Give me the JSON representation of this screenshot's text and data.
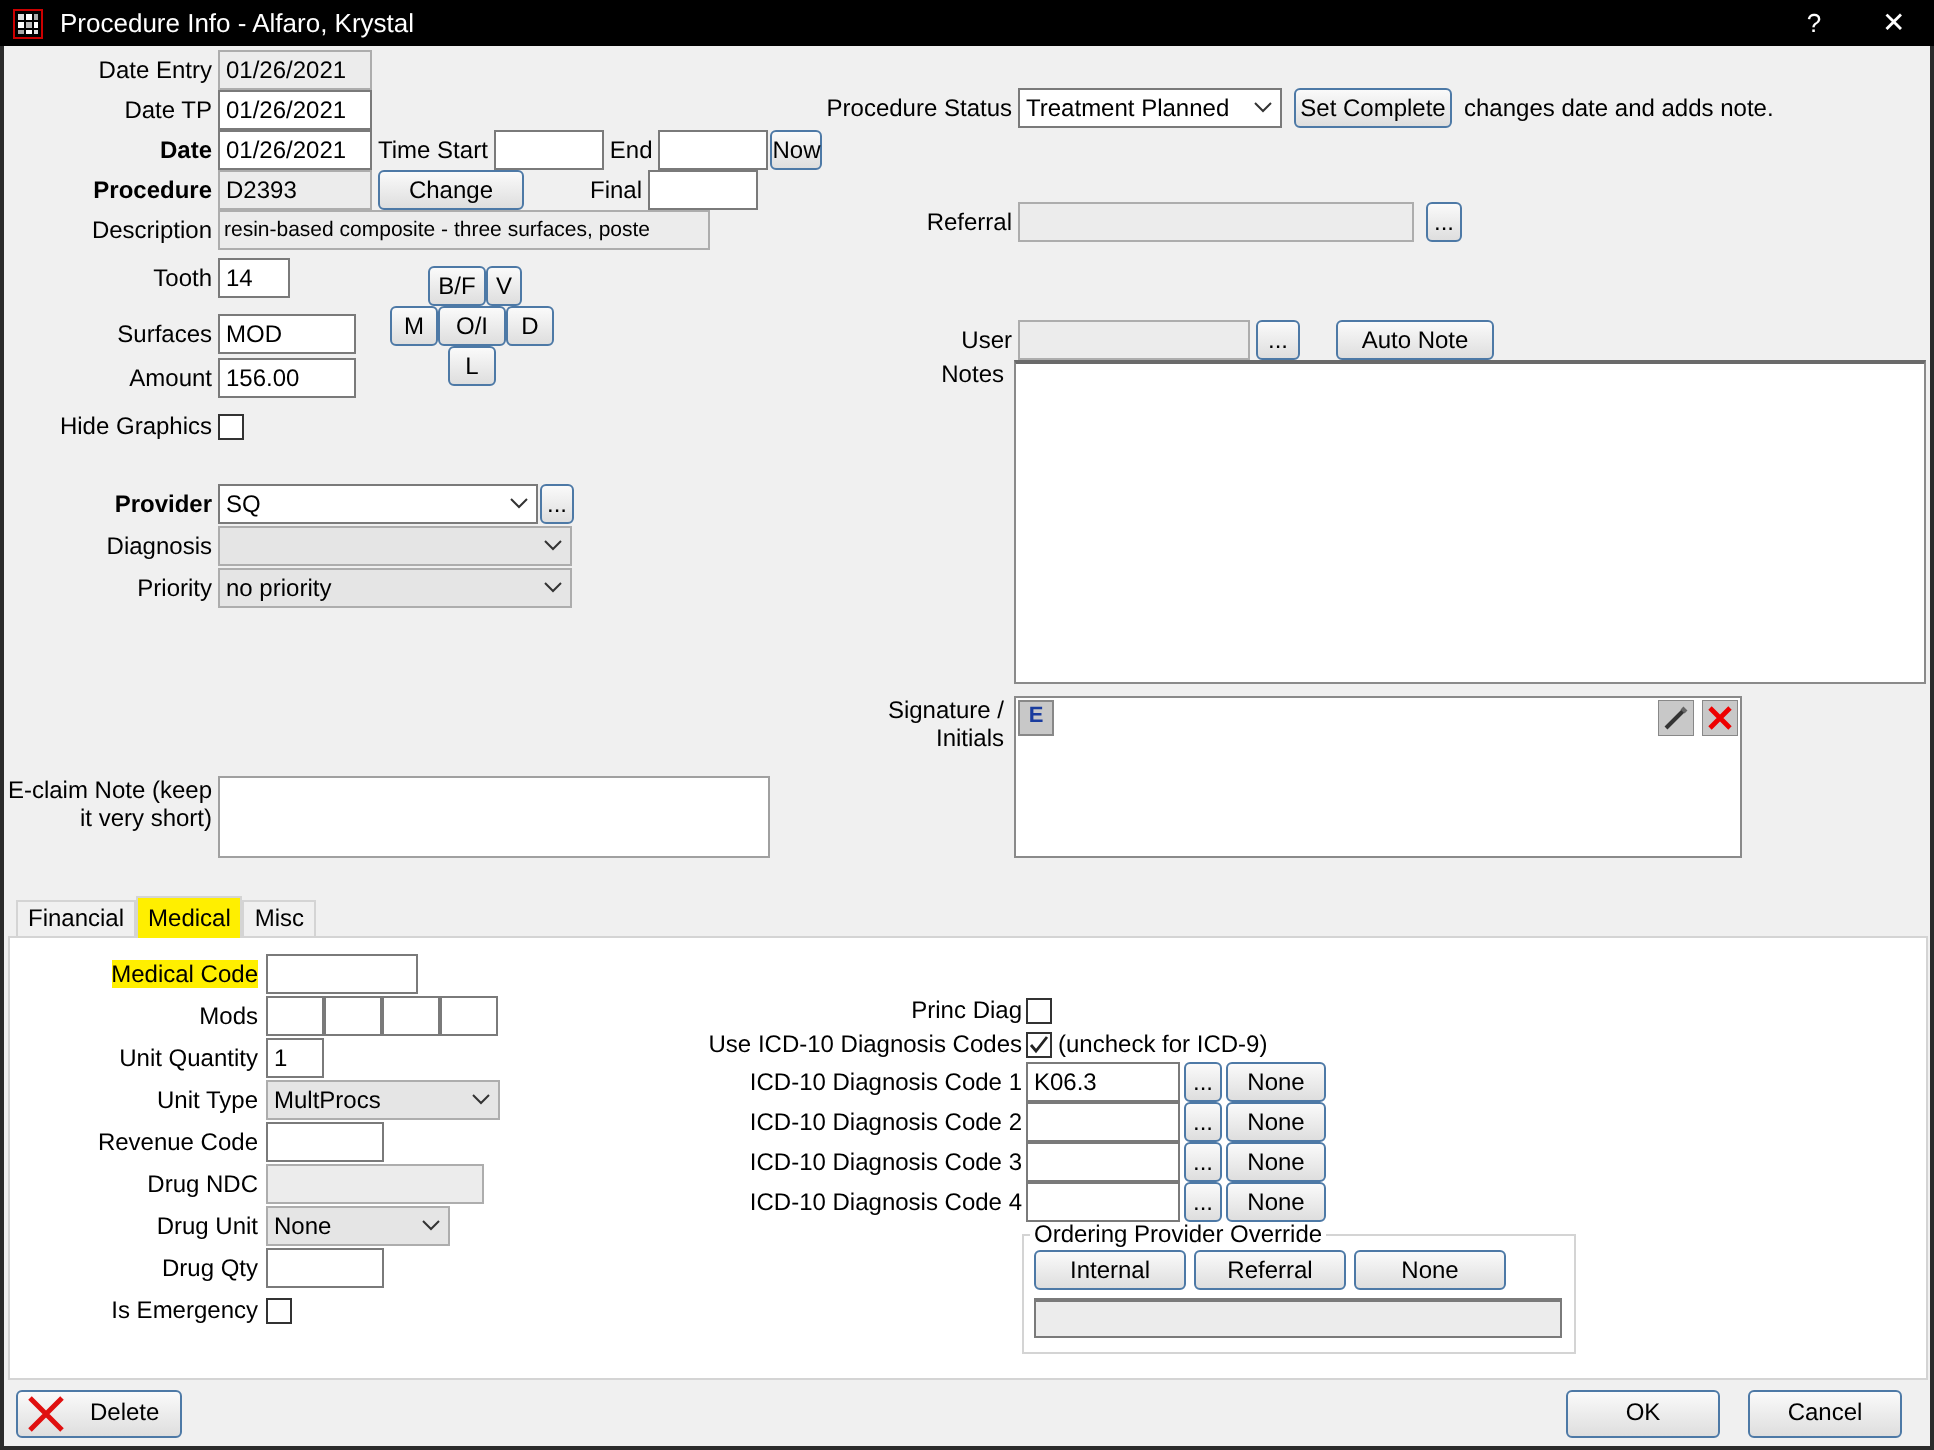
{
  "window": {
    "title": "Procedure Info - Alfaro, Krystal",
    "help": "?",
    "close": "✕"
  },
  "procedure": {
    "date_entry": {
      "label": "Date Entry",
      "value": "01/26/2021",
      "readonly": true
    },
    "date_tp": {
      "label": "Date TP",
      "value": "01/26/2021",
      "readonly": false
    },
    "date": {
      "label": "Date",
      "value": "01/26/2021",
      "readonly": false
    },
    "time_start": {
      "label": "Time Start"
    },
    "end": {
      "label": "End"
    },
    "now_button": "Now",
    "code": {
      "label": "Procedure",
      "value": "D2393",
      "readonly": true
    },
    "change_button": "Change",
    "final": {
      "label": "Final"
    },
    "description": {
      "label": "Description",
      "value": "resin-based composite - three surfaces, poste",
      "readonly": true
    },
    "tooth": {
      "label": "Tooth",
      "value": "14"
    },
    "surface_buttons": [
      "B/F",
      "V",
      "M",
      "O/I",
      "D",
      "L"
    ],
    "surfaces": {
      "label": "Surfaces",
      "value": "MOD"
    },
    "amount": {
      "label": "Amount",
      "value": "156.00"
    },
    "hide_graphics": {
      "label": "Hide Graphics",
      "checked": false
    },
    "provider": {
      "label": "Provider",
      "value": "SQ",
      "readonly": false,
      "browse": "..."
    },
    "diagnosis": {
      "label": "Diagnosis",
      "readonly": true
    },
    "priority": {
      "label": "Priority",
      "value": "no priority",
      "readonly": true
    },
    "eclaim_note": {
      "label": "E-claim Note (keep it very short)"
    }
  },
  "status": {
    "label": "Procedure Status",
    "value": "Treatment Planned",
    "readonly": false,
    "button": "Set Complete",
    "hint": "changes date and adds note."
  },
  "referral": {
    "label": "Referral",
    "readonly": true,
    "browse": "..."
  },
  "user": {
    "label": "User",
    "readonly": true,
    "browse": "...",
    "button": "Auto Note"
  },
  "notes": {
    "label": "Notes"
  },
  "signature": {
    "label": "Signature / Initials",
    "e_button": "E"
  },
  "tabs": [
    {
      "label": "Financial",
      "selected": false,
      "highlighted": false
    },
    {
      "label": "Medical",
      "selected": true,
      "highlighted": true
    },
    {
      "label": "Misc",
      "selected": false,
      "highlighted": false
    }
  ],
  "medical": {
    "medical_code": {
      "label": "Medical Code",
      "highlighted": true
    },
    "mods": {
      "label": "Mods"
    },
    "unit_quantity": {
      "label": "Unit Quantity",
      "value": "1"
    },
    "unit_type": {
      "label": "Unit Type",
      "value": "MultProcs",
      "readonly": true
    },
    "revenue_code": {
      "label": "Revenue Code"
    },
    "drug_ndc": {
      "label": "Drug NDC",
      "readonly": true
    },
    "drug_unit": {
      "label": "Drug Unit",
      "value": "None",
      "readonly": true
    },
    "drug_qty": {
      "label": "Drug Qty"
    },
    "is_emergency": {
      "label": "Is Emergency",
      "checked": false
    },
    "princ_diag": {
      "label": "Princ Diag",
      "checked": false
    },
    "use_icd10": {
      "label": "Use ICD-10 Diagnosis Codes",
      "checked": true,
      "hint": "(uncheck for ICD-9)"
    },
    "icd_codes": [
      {
        "label": "ICD-10 Diagnosis Code 1",
        "value": "K06.3",
        "browse": "...",
        "clear": "None"
      },
      {
        "label": "ICD-10 Diagnosis Code 2",
        "browse": "...",
        "clear": "None"
      },
      {
        "label": "ICD-10 Diagnosis Code 3",
        "browse": "...",
        "clear": "None"
      },
      {
        "label": "ICD-10 Diagnosis Code 4",
        "browse": "...",
        "clear": "None"
      }
    ],
    "ordering_override": {
      "title": "Ordering Provider Override",
      "buttons": [
        "Internal",
        "Referral",
        "None"
      ]
    }
  },
  "footer": {
    "delete": "Delete",
    "ok": "OK",
    "cancel": "Cancel"
  }
}
